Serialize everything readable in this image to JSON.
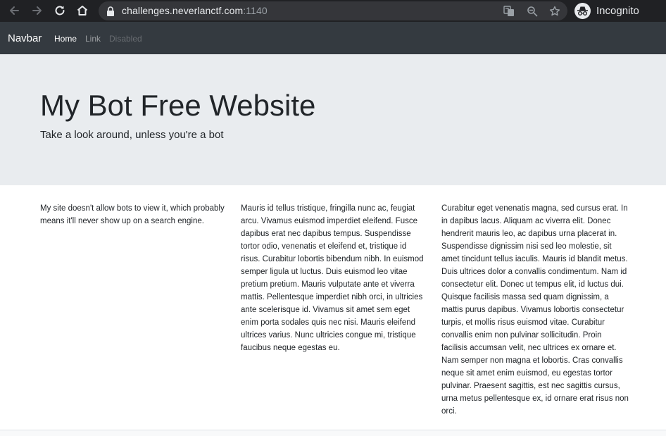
{
  "browser": {
    "url_host": "challenges.neverlanctf.com",
    "url_port": ":1140",
    "profile_label": "Incognito"
  },
  "navbar": {
    "brand": "Navbar",
    "items": [
      {
        "label": "Home"
      },
      {
        "label": "Link"
      },
      {
        "label": "Disabled"
      }
    ]
  },
  "jumbotron": {
    "title": "My Bot Free Website",
    "lead": "Take a look around, unless you're a bot"
  },
  "columns": [
    {
      "text": "My site doesn't allow bots to view it, which probably means it'll never show up on a search engine."
    },
    {
      "text": "Mauris id tellus tristique, fringilla nunc ac, feugiat arcu. Vivamus euismod imperdiet eleifend. Fusce dapibus erat nec dapibus tempus. Suspendisse tortor odio, venenatis et eleifend et, tristique id risus. Curabitur lobortis bibendum nibh. In euismod semper ligula ut luctus. Duis euismod leo vitae pretium pretium. Mauris vulputate ante et viverra mattis. Pellentesque imperdiet nibh orci, in ultricies ante scelerisque id. Vivamus sit amet sem eget enim porta sodales quis nec nisi. Mauris eleifend ultrices varius. Nunc ultricies congue mi, tristique faucibus neque egestas eu."
    },
    {
      "text": "Curabitur eget venenatis magna, sed cursus erat. In in dapibus lacus. Aliquam ac viverra elit. Donec hendrerit mauris leo, ac dapibus urna placerat in. Suspendisse dignissim nisi sed leo molestie, sit amet tincidunt tellus iaculis. Mauris id blandit metus. Duis ultrices dolor a convallis condimentum. Nam id consectetur elit. Donec ut tempus elit, id luctus dui. Quisque facilisis massa sed quam dignissim, a mattis purus dapibus. Vivamus lobortis consectetur turpis, et mollis risus euismod vitae. Curabitur convallis enim non pulvinar sollicitudin. Proin facilisis accumsan velit, nec ultrices ex ornare et. Nam semper non magna et lobortis. Cras convallis neque sit amet enim euismod, eu egestas tortor pulvinar. Praesent sagittis, est nec sagittis cursus, urna metus pellentesque ex, id ornare erat risus non orci."
    }
  ],
  "colors": {
    "chrome_bg": "#202124",
    "omnibox_bg": "#35363a",
    "navbar_bg": "#343a40",
    "jumbotron_bg": "#e9ecef",
    "text": "#212529"
  },
  "icons": {
    "back": "arrow-left-icon",
    "forward": "arrow-right-icon",
    "reload": "reload-icon",
    "home": "home-icon",
    "lock": "lock-icon",
    "translate": "translate-icon",
    "zoom": "zoom-icon",
    "bookmark": "star-icon",
    "incognito": "incognito-icon"
  }
}
